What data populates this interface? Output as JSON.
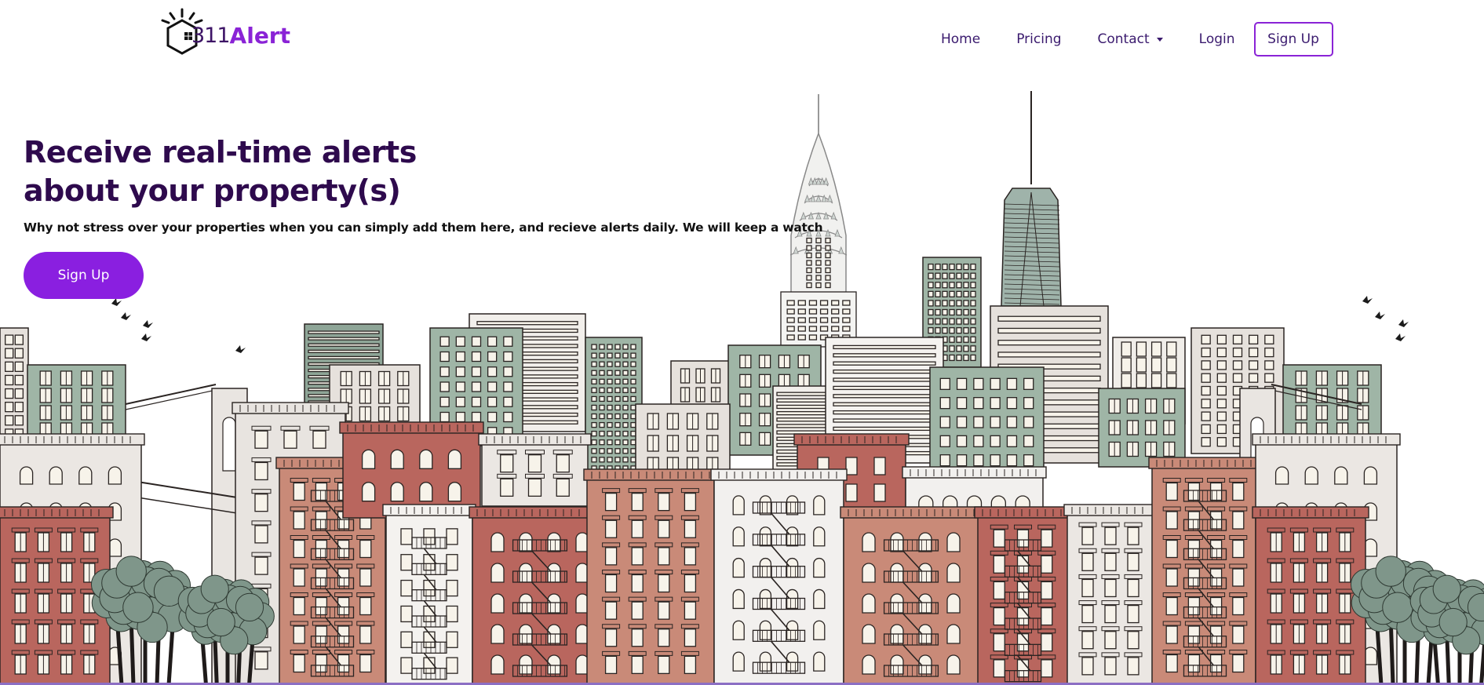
{
  "brand": {
    "number": "311",
    "name": "Alert",
    "logo_icon": "house-hexagon-alert-icon"
  },
  "nav": {
    "items": [
      {
        "label": "Home"
      },
      {
        "label": "Pricing"
      },
      {
        "label": "Contact",
        "has_dropdown": true
      },
      {
        "label": "Login"
      }
    ],
    "signup_label": "Sign Up"
  },
  "hero": {
    "title": "Receive real-time alerts about your property(s)",
    "subtitle": "Why not stress over your properties when you can simply add them here, and recieve alerts daily. We will keep a watch",
    "cta_label": "Sign Up",
    "illustration": "new-york-city-skyline-illustration"
  },
  "colors": {
    "accent": "#8a1fe0",
    "brand_dark": "#2e0a4d",
    "nav_text": "#3a1a6e",
    "brick": "#b9665e",
    "terracotta": "#c98a78",
    "sage": "#9fb5a6",
    "stone": "#e6e1dc"
  }
}
